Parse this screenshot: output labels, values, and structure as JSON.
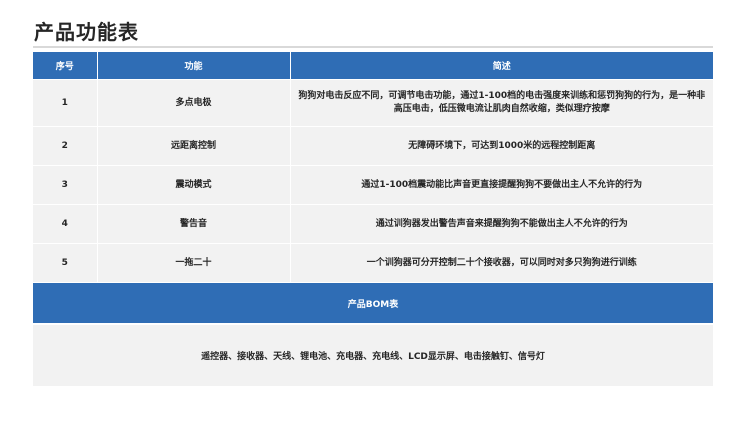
{
  "page_title": "产品功能表",
  "table": {
    "headers": {
      "index": "序号",
      "feature": "功能",
      "desc": "简述"
    },
    "rows": [
      {
        "index": "1",
        "feature": "多点电极",
        "desc": "狗狗对电击反应不同，可调节电击功能，通过1-100档的电击强度来训练和惩罚狗狗的行为，是一种非高压电击，低压微电流让肌肉自然收缩，类似理疗按摩"
      },
      {
        "index": "2",
        "feature": "远距离控制",
        "desc": "无障碍环境下，可达到1000米的远程控制距离"
      },
      {
        "index": "3",
        "feature": "震动模式",
        "desc": "通过1-100档震动能比声音更直接提醒狗狗不要做出主人不允许的行为"
      },
      {
        "index": "4",
        "feature": "警告音",
        "desc": "通过训狗器发出警告声音来提醒狗狗不能做出主人不允许的行为"
      },
      {
        "index": "5",
        "feature": "一拖二十",
        "desc": "一个训狗器可分开控制二十个接收器，可以同时对多只狗狗进行训练"
      }
    ]
  },
  "bom": {
    "title": "产品BOM表",
    "content": "遥控器、接收器、天线、锂电池、充电器、充电线、LCD显示屏、电击接触钉、信号灯"
  },
  "colors": {
    "header_blue": "#2f6db5",
    "row_gray": "#f2f2f2"
  }
}
